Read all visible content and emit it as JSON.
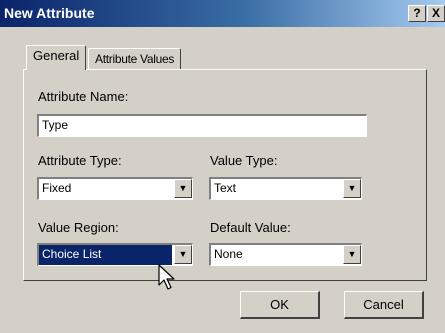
{
  "window": {
    "title": "New Attribute",
    "help_glyph": "?",
    "close_glyph": "X"
  },
  "tabs": [
    {
      "label": "General",
      "active": true
    },
    {
      "label": "Attribute Values",
      "active": false
    }
  ],
  "general": {
    "attribute_name": {
      "label": "Attribute Name:",
      "value": "Type"
    },
    "attribute_type": {
      "label": "Attribute Type:",
      "value": "Fixed"
    },
    "value_type": {
      "label": "Value Type:",
      "value": "Text"
    },
    "value_region": {
      "label": "Value Region:",
      "value": "Choice List"
    },
    "default_value": {
      "label": "Default Value:",
      "value": "None"
    }
  },
  "buttons": {
    "ok": "OK",
    "cancel": "Cancel"
  },
  "colors": {
    "titlebar_start": "#0a246a",
    "titlebar_end": "#a6caf0",
    "face": "#d4d0c8",
    "selection": "#0a246a"
  },
  "icons": {
    "dropdown": "chevron-down-icon",
    "pointer": "mouse-pointer-icon"
  }
}
